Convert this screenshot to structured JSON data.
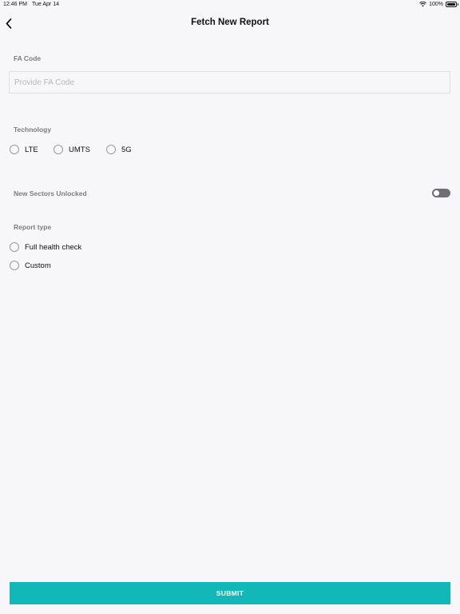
{
  "status_bar": {
    "time": "12:46 PM",
    "date": "Tue Apr 14",
    "battery": "100%"
  },
  "nav": {
    "title": "Fetch New Report"
  },
  "fa_code": {
    "label": "FA Code",
    "placeholder": "Provide FA Code",
    "value": ""
  },
  "technology": {
    "label": "Technology",
    "options": [
      "LTE",
      "UMTS",
      "5G"
    ]
  },
  "new_sectors": {
    "label": "New Sectors Unlocked",
    "enabled": false
  },
  "report_type": {
    "label": "Report type",
    "options": [
      "Full health check",
      "Custom"
    ]
  },
  "submit": {
    "label": "SUBMIT"
  },
  "colors": {
    "accent": "#12b8b8",
    "background": "#f7f7fa",
    "toggle_off": "#707074"
  }
}
